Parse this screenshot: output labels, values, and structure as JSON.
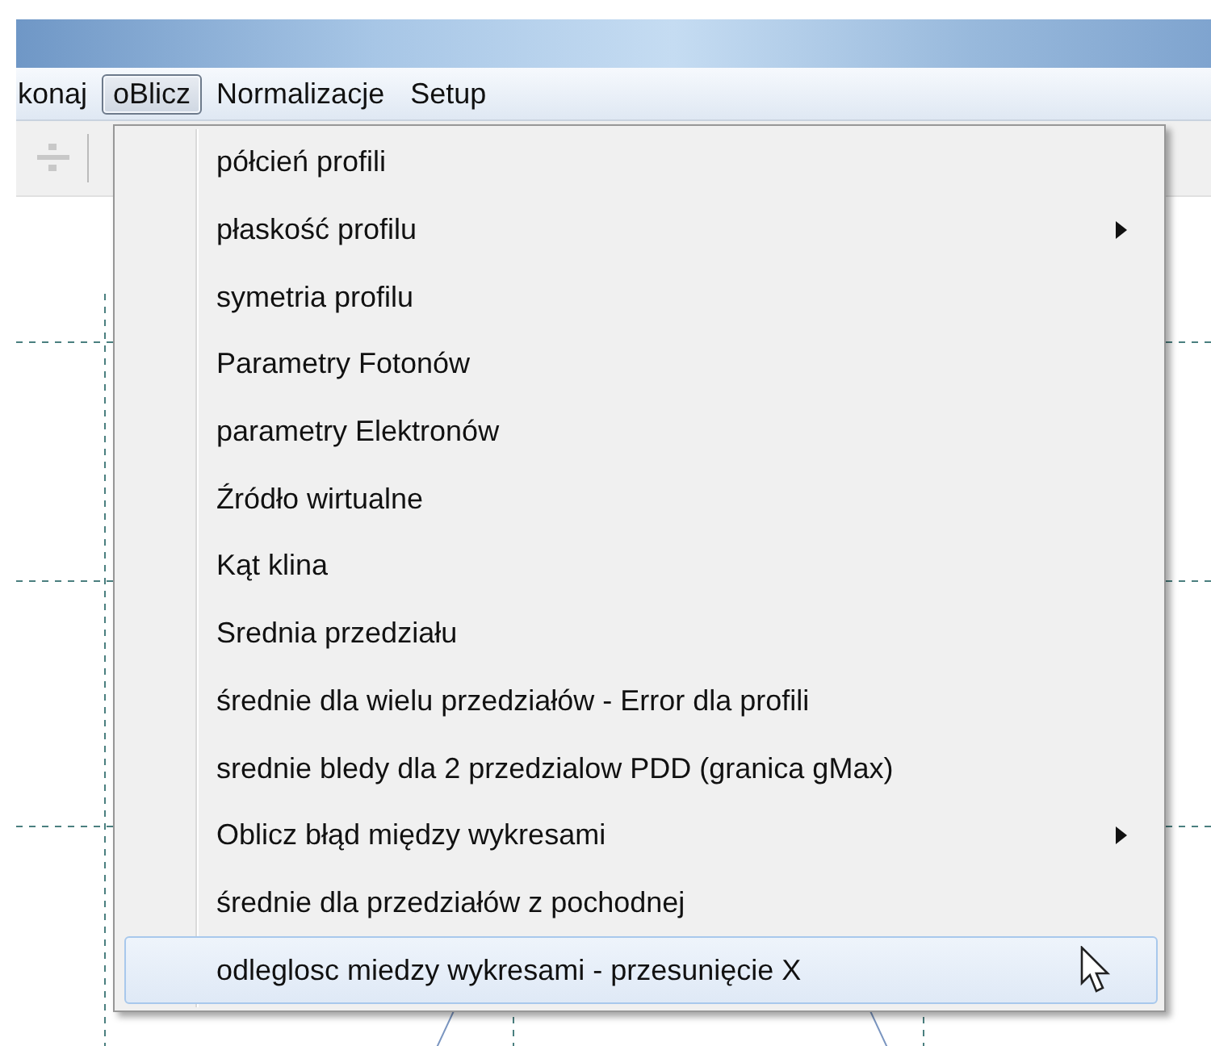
{
  "menu_bar": [
    {
      "label": "konaj",
      "selected": false
    },
    {
      "label": "oBlicz",
      "selected": true
    },
    {
      "label": "Normalizacje",
      "selected": false
    },
    {
      "label": "Setup",
      "selected": false
    }
  ],
  "menu": {
    "items": [
      {
        "label": "półcień profili",
        "submenu": false,
        "selected": false
      },
      {
        "label": "płaskość profilu",
        "submenu": true,
        "selected": false
      },
      {
        "label": "symetria profilu",
        "submenu": false,
        "selected": false
      },
      {
        "label": "Parametry Fotonów",
        "submenu": false,
        "selected": false
      },
      {
        "label": "parametry Elektronów",
        "submenu": false,
        "selected": false
      },
      {
        "label": "Źródło wirtualne",
        "submenu": false,
        "selected": false
      },
      {
        "label": "Kąt klina",
        "submenu": false,
        "selected": false
      },
      {
        "label": "Srednia przedziału",
        "submenu": false,
        "selected": false
      },
      {
        "label": "średnie dla wielu przedziałów - Error dla profili",
        "submenu": false,
        "selected": false
      },
      {
        "label": "srednie bledy dla 2 przedzialow PDD (granica gMax)",
        "submenu": false,
        "selected": false
      },
      {
        "label": "Oblicz błąd między wykresami",
        "submenu": true,
        "selected": false
      },
      {
        "label": "średnie dla przedziałów z pochodnej",
        "submenu": false,
        "selected": false
      },
      {
        "label": "odleglosc miedzy wykresami - przesunięcie X",
        "submenu": false,
        "selected": true
      }
    ]
  }
}
